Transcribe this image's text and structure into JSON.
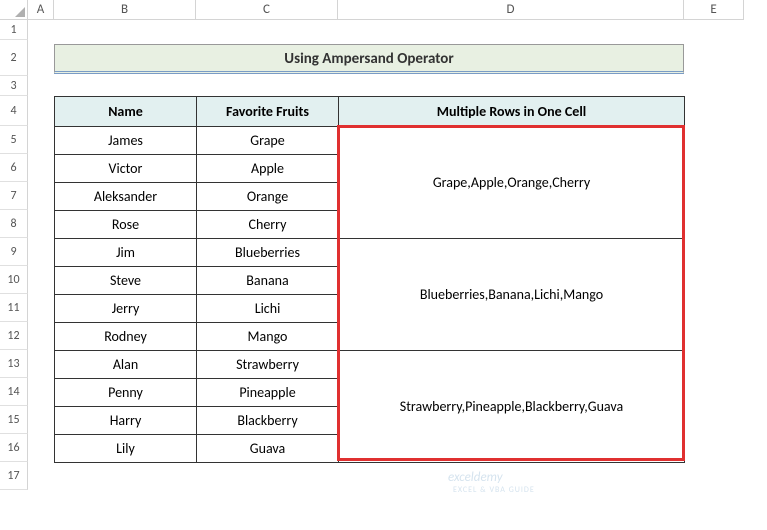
{
  "columns": [
    "A",
    "B",
    "C",
    "D",
    "E"
  ],
  "rows": [
    "1",
    "2",
    "3",
    "4",
    "5",
    "6",
    "7",
    "8",
    "9",
    "10",
    "11",
    "12",
    "13",
    "14",
    "15",
    "16",
    "17"
  ],
  "title": "Using Ampersand Operator",
  "headers": {
    "name": "Name",
    "fruits": "Favorite Fruits",
    "multi": "Multiple Rows in One Cell"
  },
  "data": [
    {
      "name": "James",
      "fruit": "Grape"
    },
    {
      "name": "Victor",
      "fruit": "Apple"
    },
    {
      "name": "Aleksander",
      "fruit": "Orange"
    },
    {
      "name": "Rose",
      "fruit": "Cherry"
    },
    {
      "name": "Jim",
      "fruit": "Blueberries"
    },
    {
      "name": "Steve",
      "fruit": "Banana"
    },
    {
      "name": "Jerry",
      "fruit": "Lichi"
    },
    {
      "name": "Rodney",
      "fruit": "Mango"
    },
    {
      "name": "Alan",
      "fruit": "Strawberry"
    },
    {
      "name": "Penny",
      "fruit": "Pineapple"
    },
    {
      "name": "Harry",
      "fruit": "Blackberry"
    },
    {
      "name": "Lily",
      "fruit": "Guava"
    }
  ],
  "merged": [
    "Grape,Apple,Orange,Cherry",
    "Blueberries,Banana,Lichi,Mango",
    "Strawberry,Pineapple,Blackberry,Guava"
  ],
  "watermark": "exceldemy",
  "watermark_sub": "EXCEL & VBA GUIDE"
}
